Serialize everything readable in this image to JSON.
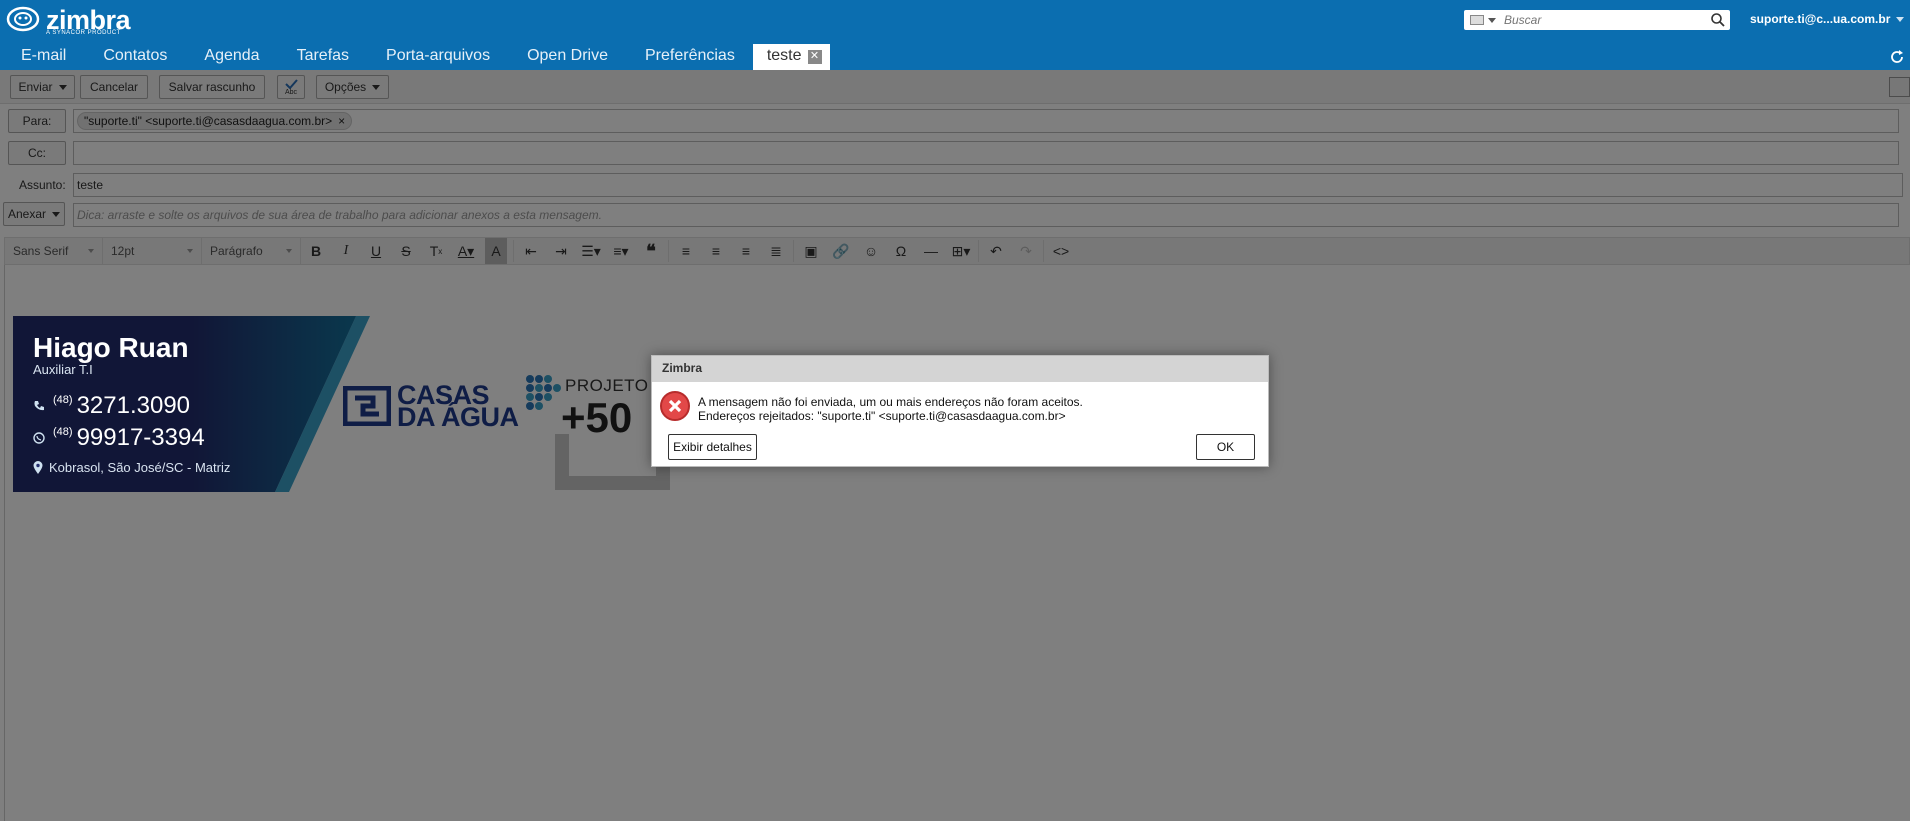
{
  "app": {
    "brand": "zimbra",
    "brand_sub": "A SYNACOR PRODUCT",
    "user": "suporte.ti@c...ua.com.br"
  },
  "search": {
    "placeholder": "Buscar"
  },
  "tabs": [
    "E-mail",
    "Contatos",
    "Agenda",
    "Tarefas",
    "Porta-arquivos",
    "Open Drive",
    "Preferências"
  ],
  "active_tab": {
    "label": "teste",
    "close": "✕"
  },
  "toolbar": {
    "send": "Enviar",
    "cancel": "Cancelar",
    "save_draft": "Salvar rascunho",
    "spell_label": "Abc",
    "options": "Opções"
  },
  "compose": {
    "to_label": "Para:",
    "to_chip": "\"suporte.ti\" <suporte.ti@casasdaagua.com.br>",
    "cc_label": "Cc:",
    "subject_label": "Assunto:",
    "subject_value": "teste",
    "attach_label": "Anexar",
    "attach_hint": "Dica: arraste e solte os arquivos de sua área de trabalho para adicionar anexos a esta mensagem."
  },
  "editor_toolbar": {
    "font": "Sans Serif",
    "size": "12pt",
    "block": "Parágrafo"
  },
  "signature": {
    "name": "Hiago Ruan",
    "role": "Auxiliar T.I",
    "phone1_ddd": "(48)",
    "phone1": "3271.3090",
    "phone2_ddd": "(48)",
    "phone2": "99917-3394",
    "address": "Kobrasol, São José/SC - Matriz",
    "company_line1": "CASAS",
    "company_line2": "DA ÁGUA",
    "project_label": "PROJETO",
    "project_number": "+50"
  },
  "dialog": {
    "title": "Zimbra",
    "line1": "A mensagem não foi enviada, um ou mais endereços não foram aceitos.",
    "line2": "Endereços rejeitados: \"suporte.ti\" <suporte.ti@casasdaagua.com.br>",
    "details_button": "Exibir detalhes",
    "ok_button": "OK"
  },
  "colors": {
    "header": "#0b6eb0",
    "signature_dark": "#232d6e",
    "signature_accent": "#3aa0c9",
    "error": "#e24848"
  }
}
